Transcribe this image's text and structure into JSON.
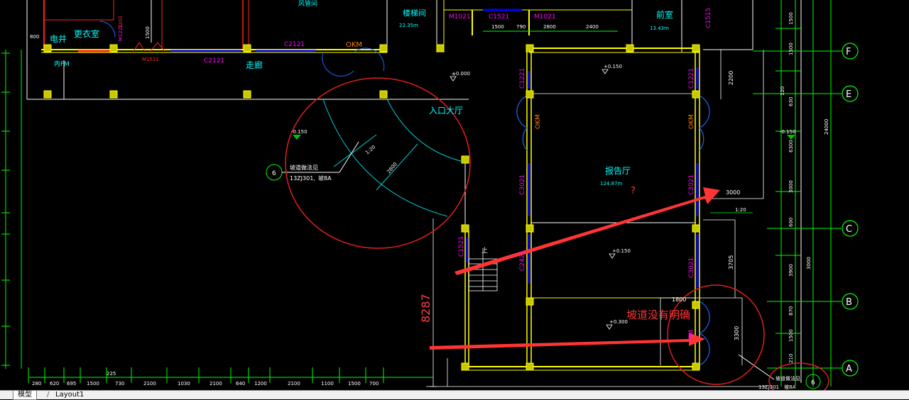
{
  "colors": {
    "background": "#000000",
    "axis_line": "#00ff00",
    "wall": "#ffff00",
    "window": "#0000ff",
    "label_magenta": "#ff00ff",
    "label_cyan": "#00ffff",
    "annotation_red": "#ff3030",
    "door_blue": "#0033ff",
    "elevation_marker": "#00c000"
  },
  "rooms": {
    "electric_well": "电井",
    "changing_room": "更衣室",
    "stairwell": "楼梯间",
    "stairwell_area": "22.35m",
    "front_room": "前室",
    "front_room_area": "13.43m",
    "corridor": "走廊",
    "entrance_hall": "入口大厅",
    "lecture_hall": "报告厅",
    "lecture_hall_area": "124.87m",
    "top_partial": "风管间"
  },
  "tags": {
    "c1521": "C1521",
    "m1021a": "M1021",
    "m1021b": "M1021",
    "c2121a": "C2121",
    "c2121b": "C2121",
    "okm_top": "OKM",
    "m1521": "M1521",
    "fm": "丙FM",
    "c1221a": "C1221",
    "c1221b": "C1221",
    "okm_left": "OKM",
    "okm_right": "OKM",
    "c3021a": "C3021",
    "c3021b": "C3021",
    "c3021c": "C3021",
    "c2421": "C2421",
    "c1521_right": "C1515",
    "m1221": "M1221",
    "fm_low": "FM",
    "c1521_lower": "C1521",
    "up": "上"
  },
  "elevations": {
    "e1": "±0.000",
    "e2": "-0.150",
    "e3": "+0.150",
    "e4": "+0.150",
    "e5": "+0.300",
    "e6": "-0.150"
  },
  "ramp": {
    "ref_line1": "坡道做法见",
    "ref_line2": "13ZJ301,",
    "ref_line3": "坡8A",
    "slope": "1:20",
    "length": "2800",
    "circle_no": "6",
    "slope2": "1:20"
  },
  "ramp_bottom": {
    "line1": "坡道做法见",
    "line2": "13ZJ301",
    "line3": "坡8A",
    "circle_no": "6"
  },
  "dims_right_inner": {
    "d1": "2200",
    "d2": "3000",
    "d3": "3705",
    "d4": "1800",
    "d5": "3300"
  },
  "dims_right_col": {
    "a1": "1500",
    "a2": "1500",
    "a3": "120",
    "a4": "630",
    "a5": "6300",
    "a6": "3000",
    "a7": "600",
    "a8": "3900",
    "a9": "870",
    "a10": "1500",
    "a11": "210"
  },
  "dims_right_outer": {
    "o1": "24000",
    "o2": "3000"
  },
  "dims_top": {
    "t1": "1500",
    "t2": "790",
    "t3": "2800",
    "t4": "2400",
    "t5": "800",
    "t6": "1200",
    "t7": "1500"
  },
  "dims_bottom": [
    "280",
    "620",
    "695",
    "1500",
    "730",
    "2100",
    "1030",
    "2100",
    "640",
    "1200",
    "2100",
    "1100",
    "1500",
    "700"
  ],
  "dims_bottom_small": "225",
  "dim_vertical_big": "8287",
  "axes": {
    "f": "F",
    "e": "E",
    "c": "C",
    "b": "B",
    "a": "A"
  },
  "annotation_text": "坡道没有明确",
  "question_mark": "?",
  "tabs": {
    "model": "模型",
    "layout1": "Layout1"
  }
}
